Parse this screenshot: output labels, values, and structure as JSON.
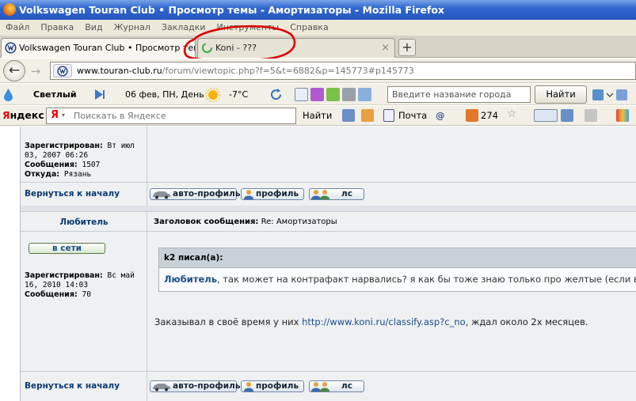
{
  "window": {
    "title": "Volkswagen Touran Club • Просмотр темы - Амортизаторы - Mozilla Firefox"
  },
  "menu": [
    "Файл",
    "Правка",
    "Вид",
    "Журнал",
    "Закладки",
    "Инструменты",
    "Справка"
  ],
  "tabs": [
    {
      "label": "Volkswagen Touran Club • Просмотр тем...",
      "close": "×"
    },
    {
      "label": "Koni - ???",
      "close": "×"
    }
  ],
  "new_tab": "+",
  "address": {
    "host": "www.touran-club.ru",
    "path": "/forum/viewtopic.php?f=5&t=6882&p=145773#p145773"
  },
  "weather": {
    "city": "Светлый",
    "date": "06 фев, ПН, День",
    "temp": "-7°C",
    "city_placeholder": "Введите название города",
    "find_label": "Найти"
  },
  "yandex": {
    "logo_first": "Я",
    "logo_rest": "ндекс",
    "search_placeholder": "Поискать в Яндексе",
    "find_label": "Найти",
    "mail_label": "Почта",
    "count": "274"
  },
  "forum": {
    "post1": {
      "registered_label": "Зарегистрирован:",
      "registered_value": "Вт июл",
      "registered_value2": "03, 2007 06:26",
      "posts_label": "Сообщения:",
      "posts_value": "1507",
      "from_label": "Откуда:",
      "from_value": "Рязань",
      "back_link": "Вернуться к началу",
      "btn_auto": "авто-профиль",
      "btn_profile": "профиль",
      "btn_pm": "лс"
    },
    "post2": {
      "author": "Любитель",
      "subject_label": "Заголовок сообщения:",
      "subject_value": "Re: Амортизаторы",
      "online": "в сети",
      "registered_label": "Зарегистрирован:",
      "registered_value": "Вс май",
      "registered_value2": "16, 2010 14:03",
      "posts_label": "Сообщения:",
      "posts_value": "70",
      "quote_author": "k2 писал(а):",
      "quote_name": "Любитель",
      "quote_text": ", так может на контрафакт нарвались? я как бы тоже знаю только про желтые (если в ц",
      "text_before": "Заказывал в своё время у них ",
      "link": "http://www.koni.ru/classify.asp?c_no",
      "text_after": ", ждал около 2х месяцев.",
      "back_link": "Вернуться к началу",
      "btn_auto": "авто-профиль",
      "btn_profile": "профиль",
      "btn_pm": "лс"
    }
  },
  "colors": {
    "titlebar": "#2f67cf",
    "annotation_circle": "#e00000",
    "link": "#1a4d8a"
  }
}
